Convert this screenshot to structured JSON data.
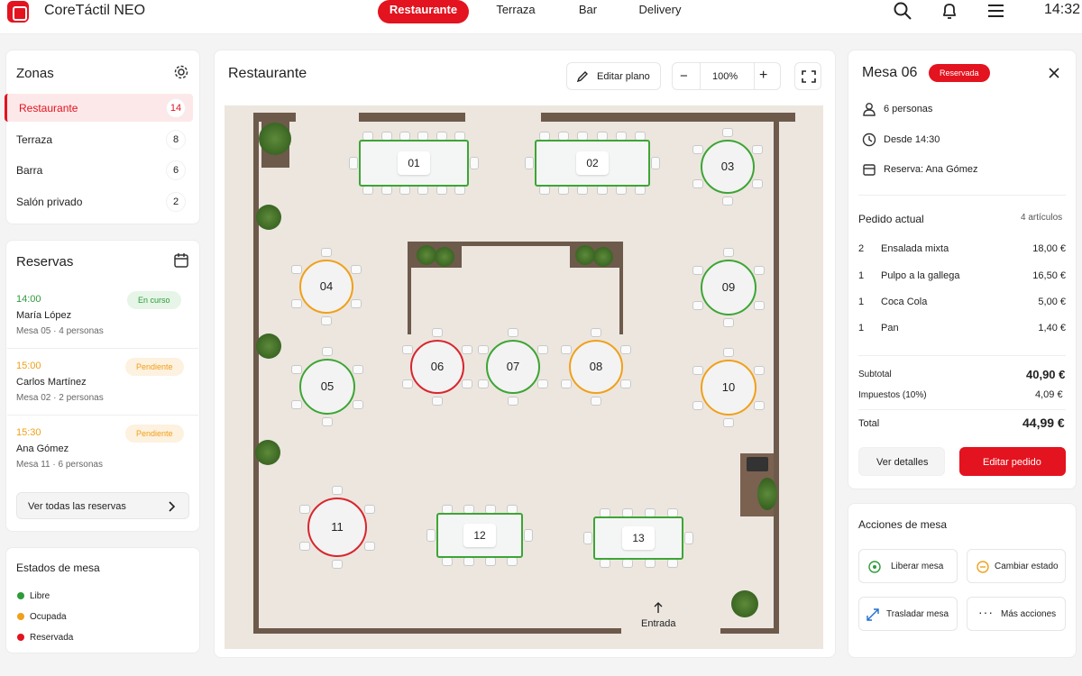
{
  "app": {
    "title": "CoreTáctil NEO",
    "time": "14:32"
  },
  "nav": {
    "tabs": [
      {
        "label": "Restaurante",
        "active": true
      },
      {
        "label": "Terraza",
        "active": false
      },
      {
        "label": "Bar",
        "active": false
      },
      {
        "label": "Delivery",
        "active": false
      }
    ]
  },
  "zones": {
    "title": "Zonas",
    "items": [
      {
        "label": "Restaurante",
        "count": "14",
        "active": true
      },
      {
        "label": "Terraza",
        "count": "8"
      },
      {
        "label": "Barra",
        "count": "6"
      },
      {
        "label": "Salón privado",
        "count": "2"
      }
    ]
  },
  "reservations": {
    "title": "Reservas",
    "items": [
      {
        "time": "14:00",
        "name": "María López",
        "detail": "Mesa 05 · 4 personas",
        "status": "En curso",
        "status_color": "#2e9b3a"
      },
      {
        "time": "15:00",
        "name": "Carlos Martínez",
        "detail": "Mesa 02 · 2 personas",
        "status": "Pendiente",
        "status_color": "#f0a01a"
      },
      {
        "time": "15:30",
        "name": "Ana Gómez",
        "detail": "Mesa 11 · 6 personas",
        "status": "Pendiente",
        "status_color": "#f0a01a"
      }
    ],
    "view_all": "Ver todas las reservas"
  },
  "legend": {
    "title": "Estados de mesa",
    "items": [
      {
        "label": "Libre",
        "color": "#2e9b3a"
      },
      {
        "label": "Ocupada",
        "color": "#f0a01a"
      },
      {
        "label": "Reservada",
        "color": "#e3131f"
      }
    ]
  },
  "floor": {
    "title": "Restaurante",
    "edit_label": "Editar plano",
    "zoom": "100%",
    "entrance": "Entrada",
    "tables": [
      "01",
      "02",
      "03",
      "04",
      "05",
      "06",
      "07",
      "08",
      "09",
      "10",
      "11",
      "12",
      "13"
    ]
  },
  "detail": {
    "title": "Mesa 06",
    "status": "Reservada",
    "people": "6 personas",
    "since": "Desde 14:30",
    "reservation": "Reserva: Ana Gómez",
    "order_title": "Pedido actual",
    "order_count": "4 artículos",
    "items": [
      {
        "qty": "2",
        "name": "Ensalada mixta",
        "price": "18,00 €"
      },
      {
        "qty": "1",
        "name": "Pulpo a la gallega",
        "price": "16,50 €"
      },
      {
        "qty": "1",
        "name": "Coca Cola",
        "price": "5,00 €"
      },
      {
        "qty": "1",
        "name": "Pan",
        "price": "1,40 €"
      }
    ],
    "subtotal_label": "Subtotal",
    "subtotal": "40,90 €",
    "tax_label": "Impuestos (10%)",
    "tax": "4,09 €",
    "total_label": "Total",
    "total": "44,99 €",
    "details_btn": "Ver detalles",
    "edit_btn": "Editar pedido"
  },
  "actions": {
    "title": "Acciones de mesa",
    "items": [
      {
        "label": "Liberar mesa"
      },
      {
        "label": "Cambiar estado"
      },
      {
        "label": "Trasladar mesa"
      },
      {
        "label": "Más acciones"
      }
    ]
  },
  "colors": {
    "accent": "#e3131f",
    "free": "#3da535",
    "occupied": "#f0a01a",
    "reserved": "#d8262e"
  }
}
